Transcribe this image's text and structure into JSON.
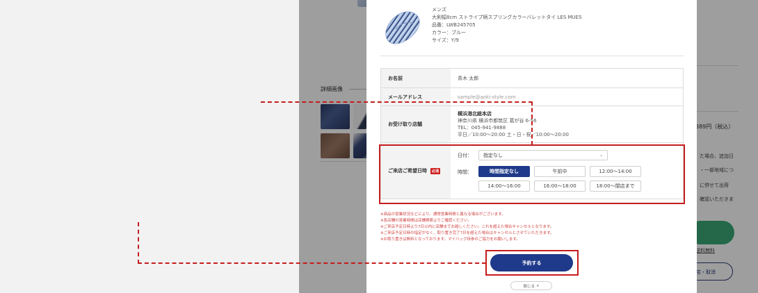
{
  "background": {
    "detail_title": "詳細画像",
    "price_fragment": "389円（税込）",
    "text_fragments": [
      "た場合、追加日",
      "・一部地域につ",
      "に併せて出荷",
      "確認いただきま"
    ],
    "link_fragment": "送料無料",
    "outline_button_fragment": "店・取消"
  },
  "product": {
    "gender": "メンズ",
    "name": "大剣幅8cm ストライプ柄スプリングカラーバレットタイ LES MUES",
    "sku": "品番：LWB245705",
    "color": "カラー：ブルー",
    "size": "サイズ：Y/9"
  },
  "form": {
    "name_label": "お名前",
    "name_value": "青木 太郎",
    "email_label": "メールアドレス",
    "email_placeholder": "sample@aoki-style.com",
    "store_label": "お受け取り店舗",
    "store_name": "横浜港北総本店",
    "store_address": "神奈川県 横浜市都筑区 葛が谷 6-56",
    "store_tel": "TEL：045-941-9888",
    "store_hours": "平日／10:00～20:00 土・日・祝／10:00～20:00",
    "visit_label": "ご来店ご希望日時",
    "required_badge": "必須",
    "date_label": "日付：",
    "date_value": "指定なし",
    "time_label": "時間：",
    "time_slots": [
      "時間指定なし",
      "午前中",
      "12:00～14:00",
      "14:00～16:00",
      "16:00～18:00",
      "18:00～閉店まで"
    ],
    "selected_slot": "時間指定なし"
  },
  "notes": [
    "※商品の営業状況などにより、通常営業時間と異なる場合がございます。",
    "※各店舗の営業時間は店舗検索よりご確認ください。",
    "※ご来店予定日時より7日以内に店舗までお越しください。これを超えた場合キャンセルとなります。",
    "※ご来店予定日時の指定がなく、取り置き完了7日を超えた場合はキャンセルとさせていただきます。",
    "※お取り置きは無料となっております。マイバッグ持参のご協力をお願いします。"
  ],
  "buttons": {
    "submit": "予約する",
    "close": "閉じる"
  },
  "colors": {
    "primary": "#1f3a8a",
    "highlight": "#c41c1c",
    "note_text": "#d04444"
  }
}
